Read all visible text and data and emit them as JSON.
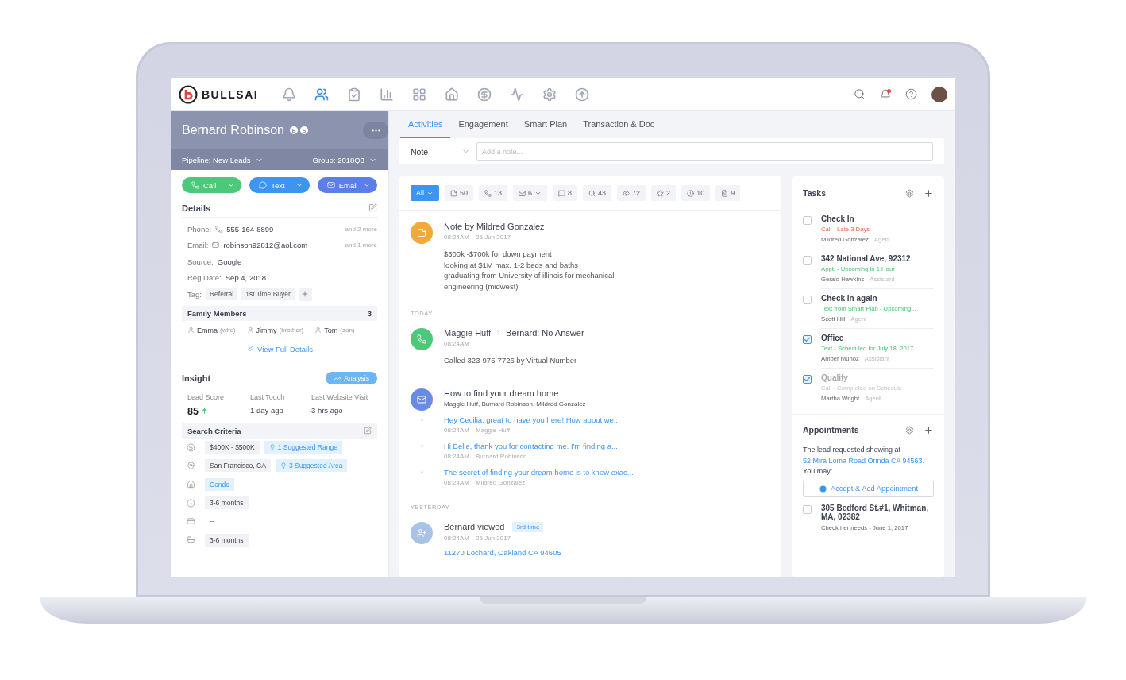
{
  "app": {
    "logo": "BULLSAI"
  },
  "nav_items": [
    {
      "kind": "alerts",
      "selected": false
    },
    {
      "kind": "contacts",
      "selected": true
    },
    {
      "kind": "tasks",
      "selected": false
    },
    {
      "kind": "reports",
      "selected": false
    },
    {
      "kind": "dashboard",
      "selected": false
    },
    {
      "kind": "listings",
      "selected": false
    },
    {
      "kind": "transactions",
      "selected": false
    },
    {
      "kind": "activity",
      "selected": false
    },
    {
      "kind": "settings",
      "selected": false
    },
    {
      "kind": "upload",
      "selected": false
    }
  ],
  "notifications": {
    "unread": true
  },
  "contact": {
    "name": "Bernard Robinson",
    "badges": [
      "B",
      "S"
    ],
    "pipeline": "Pipeline: New Leads",
    "group": "Group: 2018Q3"
  },
  "action_buttons": [
    {
      "kind": "call",
      "label": "Call"
    },
    {
      "kind": "text",
      "label": "Text"
    },
    {
      "kind": "email",
      "label": "Email"
    }
  ],
  "details": {
    "title": "Details",
    "fields": [
      {
        "kind": "phone",
        "label": "Phone:",
        "value": "555-164-8899",
        "more": "and 2 more"
      },
      {
        "kind": "email",
        "label": "Email:",
        "value": "robinson92812@aol.com",
        "more": "and 1 more"
      },
      {
        "kind": "plain",
        "label": "Source:",
        "value": "Google"
      },
      {
        "kind": "plain",
        "label": "Reg Date:",
        "value": "Sep 4, 2018"
      }
    ],
    "tag_label": "Tag:",
    "tags": [
      "Referral",
      "1st Time Buyer"
    ]
  },
  "family": {
    "title": "Family Members",
    "count": "3",
    "members": [
      {
        "name": "Emma",
        "relation": "(wife)"
      },
      {
        "name": "Jimmy",
        "relation": "(brother)"
      },
      {
        "name": "Tom",
        "relation": "(son)"
      }
    ],
    "view_full": "View Full Details"
  },
  "insight": {
    "title": "Insight",
    "button": "Analysis",
    "stats": [
      {
        "label": "Lead Score",
        "value": "85",
        "rising": true
      },
      {
        "label": "Last Touch",
        "value": "1 day ago"
      },
      {
        "label": "Last Website Visit",
        "value": "3 hrs ago"
      }
    ]
  },
  "search_criteria": {
    "title": "Search Criteria",
    "rows": [
      {
        "kind": "price",
        "chips": [
          {
            "text": "$400K - $500K",
            "suggested": false,
            "highlighted": false
          },
          {
            "text": "1 Suggested Range",
            "suggested": true,
            "highlighted": true
          }
        ]
      },
      {
        "kind": "location",
        "chips": [
          {
            "text": "San Francisco, CA",
            "suggested": false,
            "highlighted": false
          },
          {
            "text": "3 Suggested Area",
            "suggested": true,
            "highlighted": true
          }
        ]
      },
      {
        "kind": "property",
        "chips": [
          {
            "text": "Condo",
            "suggested": false,
            "highlighted": true
          }
        ]
      },
      {
        "kind": "timeframe",
        "chips": [
          {
            "text": "3-6 months",
            "suggested": false,
            "highlighted": false
          }
        ]
      },
      {
        "kind": "beds",
        "empty_text": "--"
      },
      {
        "kind": "baths",
        "chips": [
          {
            "text": "3-6 months",
            "suggested": false,
            "highlighted": false
          }
        ]
      }
    ]
  },
  "tabs": [
    {
      "label": "Activities",
      "selected": true
    },
    {
      "label": "Engagement",
      "selected": false
    },
    {
      "label": "Smart Plan",
      "selected": false
    },
    {
      "label": "Transaction & Doc",
      "selected": false
    }
  ],
  "note_bar": {
    "type": "Note",
    "placeholder": "Add a note..."
  },
  "filters": [
    {
      "kind": "all",
      "label": "All",
      "selected": true,
      "dropdown": true
    },
    {
      "kind": "notes",
      "label": "50",
      "selected": false,
      "dropdown": false
    },
    {
      "kind": "calls",
      "label": "13",
      "selected": false,
      "dropdown": false
    },
    {
      "kind": "emails",
      "label": "6",
      "selected": false,
      "dropdown": true
    },
    {
      "kind": "texts",
      "label": "8",
      "selected": false,
      "dropdown": false
    },
    {
      "kind": "searches",
      "label": "43",
      "selected": false,
      "dropdown": false
    },
    {
      "kind": "views",
      "label": "72",
      "selected": false,
      "dropdown": false
    },
    {
      "kind": "favorites",
      "label": "2",
      "selected": false,
      "dropdown": false
    },
    {
      "kind": "alerts",
      "label": "10",
      "selected": false,
      "dropdown": false
    },
    {
      "kind": "forms",
      "label": "9",
      "selected": false,
      "dropdown": false
    }
  ],
  "feed": [
    {
      "kind": "note",
      "title": "Note by Mildred Gonzalez",
      "time": "08:24AM",
      "date": "25 Jun 2017",
      "body": [
        "$300k -$700k for down payment",
        "looking at $1M max. 1-2 beds and baths",
        "graduating from University of illinois for mechanical",
        "engineering (midwest)"
      ]
    },
    {
      "kind": "section",
      "label": "TODAY"
    },
    {
      "kind": "call",
      "from": "Maggie Huff",
      "to": "Bernard: No Answer",
      "time": "08:24AM",
      "body": [
        "Called 323-975-7726 by Virtual Number"
      ]
    },
    {
      "kind": "email",
      "title": "How to find your dream home",
      "participants": "Maggie Huff, Burnard Robinson, Mildred Gonzalez",
      "messages": [
        {
          "text": "Hey Cecilia, great to have you here! How about we...",
          "time": "08:24AM",
          "author": "Maggie Huff"
        },
        {
          "text": "Hi Belle, thank you for contacting me. I'm finding a...",
          "time": "08:24AM",
          "author": "Burnard Robinson"
        },
        {
          "text": "The secret of finding your dream home is to know exac...",
          "time": "08:24AM",
          "author": "Mildred Gonzalez"
        }
      ]
    },
    {
      "kind": "section",
      "label": "YESTERDAY"
    },
    {
      "kind": "view",
      "title": "Bernard viewed",
      "badge": "3rd time",
      "time": "08:24AM",
      "date": "25 Jun 2017",
      "link": "11270 Lochard, Oakland CA 94605"
    }
  ],
  "tasks": {
    "title": "Tasks",
    "items": [
      {
        "title": "Check In",
        "status": "Call - Late 3 Days",
        "overdue": true,
        "completed": false,
        "assignee": "Mildred Gonzalez",
        "role": "Agent",
        "checked": false
      },
      {
        "title": "342 National Ave, 92312",
        "status": "Appt. - Upcoming in 1 Hour",
        "overdue": false,
        "completed": false,
        "assignee": "Gerald Hawkins",
        "role": "Assistant",
        "checked": false
      },
      {
        "title": "Check in again",
        "status": "Text from Smart Plan - Upcoming...",
        "overdue": false,
        "completed": false,
        "assignee": "Scott Hill",
        "role": "Agent",
        "checked": false
      },
      {
        "title": "Office",
        "status": "Text - Scheduled for July 18, 2017",
        "overdue": false,
        "completed": false,
        "assignee": "Amber Munoz",
        "role": "Assistant",
        "checked": true
      },
      {
        "title": "Qualify",
        "status": "Call - Completed on Schedule",
        "overdue": false,
        "completed": true,
        "assignee": "Martha Wright",
        "role": "Agent",
        "checked": true
      }
    ]
  },
  "appointments": {
    "title": "Appointments",
    "message": "The lead requested showing at",
    "address": "52 Mira Loma Road Orinda CA 94563.",
    "prompt": "You may:",
    "button": "Accept & Add Appointment",
    "items": [
      {
        "title": "305 Bedford St.#1, Whitman, MA, 02382",
        "note": "Check her needs - June 1, 2017",
        "checked": false
      }
    ]
  }
}
